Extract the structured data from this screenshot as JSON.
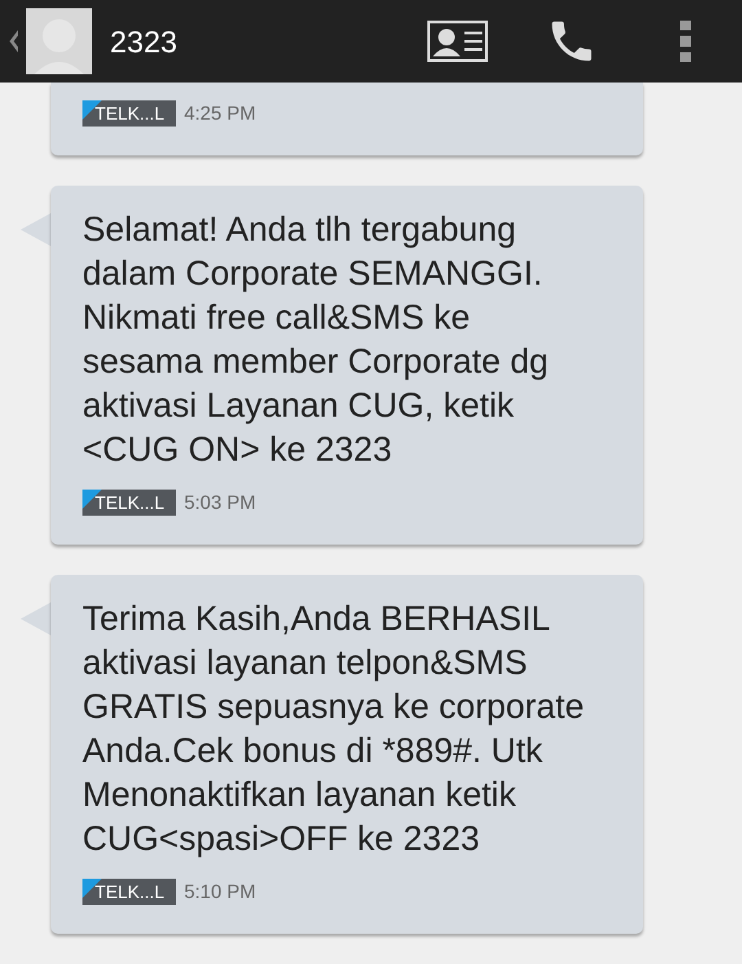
{
  "header": {
    "title": "2323"
  },
  "messages": [
    {
      "sim": "TELK...L",
      "time": "4:25 PM"
    },
    {
      "text": "Selamat! Anda tlh tergabung dalam Corporate SEMANGGI. Nikmati free call&SMS ke sesama member Corporate dg aktivasi Layanan CUG, ketik <CUG ON> ke 2323",
      "sim": "TELK...L",
      "time": "5:03 PM"
    },
    {
      "text": "Terima Kasih,Anda BERHASIL aktivasi layanan telpon&SMS GRATIS sepuasnya ke corporate Anda.Cek bonus di *889#. Utk Menonaktifkan layanan ketik CUG<spasi>OFF ke 2323",
      "sim": "TELK...L",
      "time": "5:10 PM"
    }
  ]
}
